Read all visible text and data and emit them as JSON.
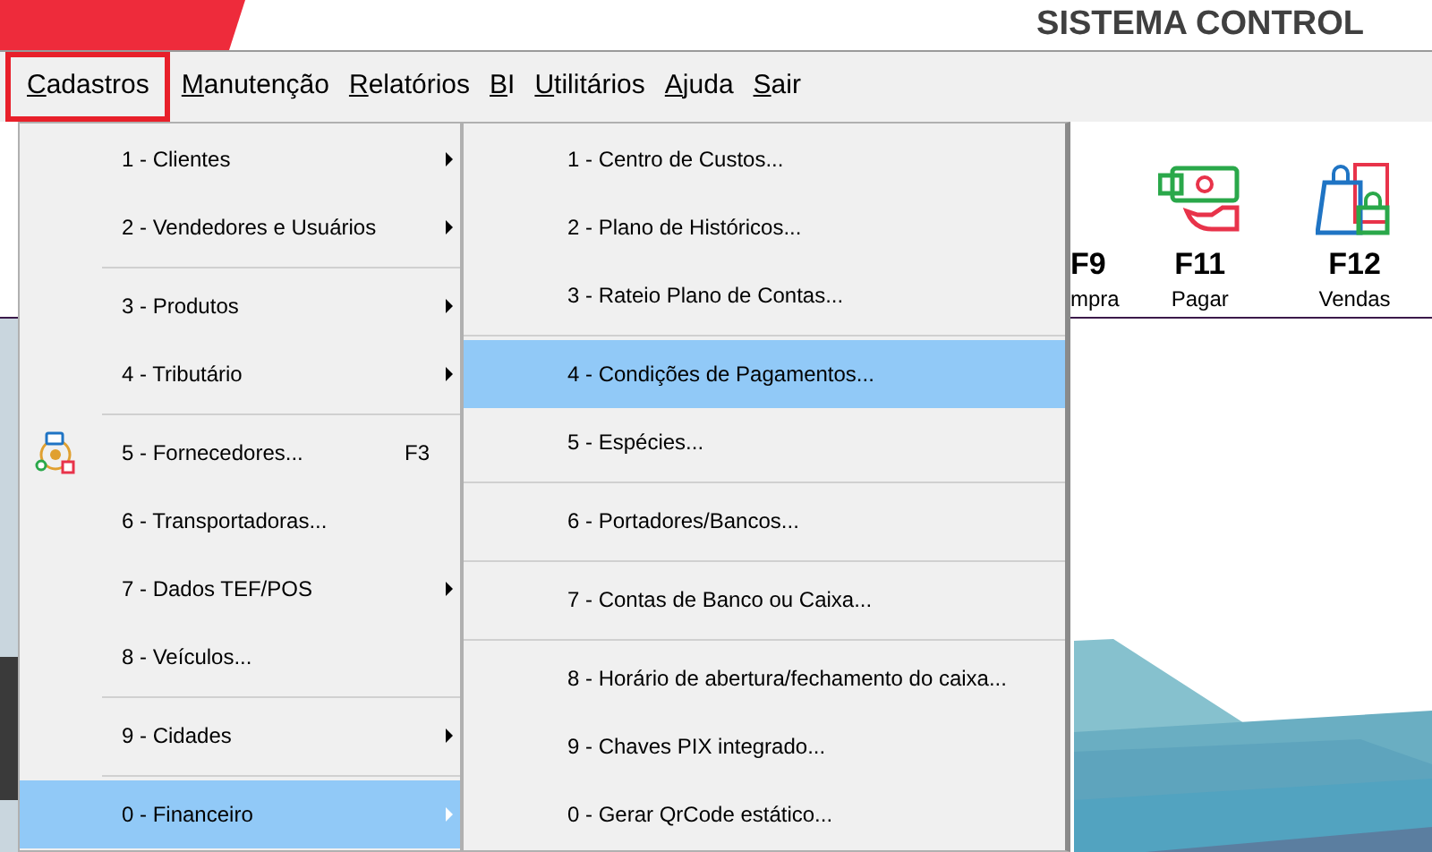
{
  "header": {
    "title": "SISTEMA CONTROL"
  },
  "menubar": [
    {
      "label": "Cadastros",
      "selected": true
    },
    {
      "label": "Manutenção",
      "selected": false
    },
    {
      "label": "Relatórios",
      "selected": false
    },
    {
      "label": "BI",
      "selected": false
    },
    {
      "label": "Utilitários",
      "selected": false
    },
    {
      "label": "Ajuda",
      "selected": false
    },
    {
      "label": "Sair",
      "selected": false
    }
  ],
  "toolbar": [
    {
      "key": "F9",
      "label": "mpra",
      "kind": "cut"
    },
    {
      "key": "F11",
      "label": "Pagar",
      "kind": "pay"
    },
    {
      "key": "F12",
      "label": "Vendas",
      "kind": "sales"
    }
  ],
  "menu": [
    {
      "kind": "item",
      "label": "1 - Clientes",
      "submenu": true,
      "selected": false
    },
    {
      "kind": "item",
      "label": "2 - Vendedores e Usuários",
      "submenu": true,
      "selected": false
    },
    {
      "kind": "separator"
    },
    {
      "kind": "item",
      "label": "3 - Produtos",
      "submenu": true,
      "selected": false
    },
    {
      "kind": "item",
      "label": "4 - Tributário",
      "submenu": true,
      "selected": false
    },
    {
      "kind": "separator"
    },
    {
      "kind": "item",
      "label": "5 - Fornecedores...",
      "shortcut": "F3",
      "icon": true,
      "selected": false
    },
    {
      "kind": "item",
      "label": "6 - Transportadoras...",
      "selected": false
    },
    {
      "kind": "item",
      "label": "7 - Dados TEF/POS",
      "submenu": true,
      "selected": false
    },
    {
      "kind": "item",
      "label": "8 - Veículos...",
      "selected": false
    },
    {
      "kind": "separator"
    },
    {
      "kind": "item",
      "label": "9 - Cidades",
      "submenu": true,
      "selected": false
    },
    {
      "kind": "separator"
    },
    {
      "kind": "item",
      "label": "0 - Financeiro",
      "submenu": true,
      "selected": true
    }
  ],
  "submenu": [
    {
      "kind": "item",
      "label": "1 - Centro de Custos...",
      "selected": false
    },
    {
      "kind": "item",
      "label": "2 - Plano de Históricos...",
      "selected": false
    },
    {
      "kind": "item",
      "label": "3 - Rateio Plano de Contas...",
      "selected": false
    },
    {
      "kind": "separator"
    },
    {
      "kind": "item",
      "label": "4 - Condições de Pagamentos...",
      "selected": true
    },
    {
      "kind": "item",
      "label": "5 - Espécies...",
      "selected": false
    },
    {
      "kind": "separator"
    },
    {
      "kind": "item",
      "label": "6 - Portadores/Bancos...",
      "selected": false
    },
    {
      "kind": "separator"
    },
    {
      "kind": "item",
      "label": "7 - Contas de Banco ou Caixa...",
      "selected": false
    },
    {
      "kind": "separator"
    },
    {
      "kind": "item",
      "label": "8 - Horário de abertura/fechamento do caixa...",
      "selected": false
    },
    {
      "kind": "item",
      "label": "9 - Chaves PIX integrado...",
      "selected": false
    },
    {
      "kind": "item",
      "label": "0 - Gerar QrCode estático...",
      "selected": false
    }
  ]
}
